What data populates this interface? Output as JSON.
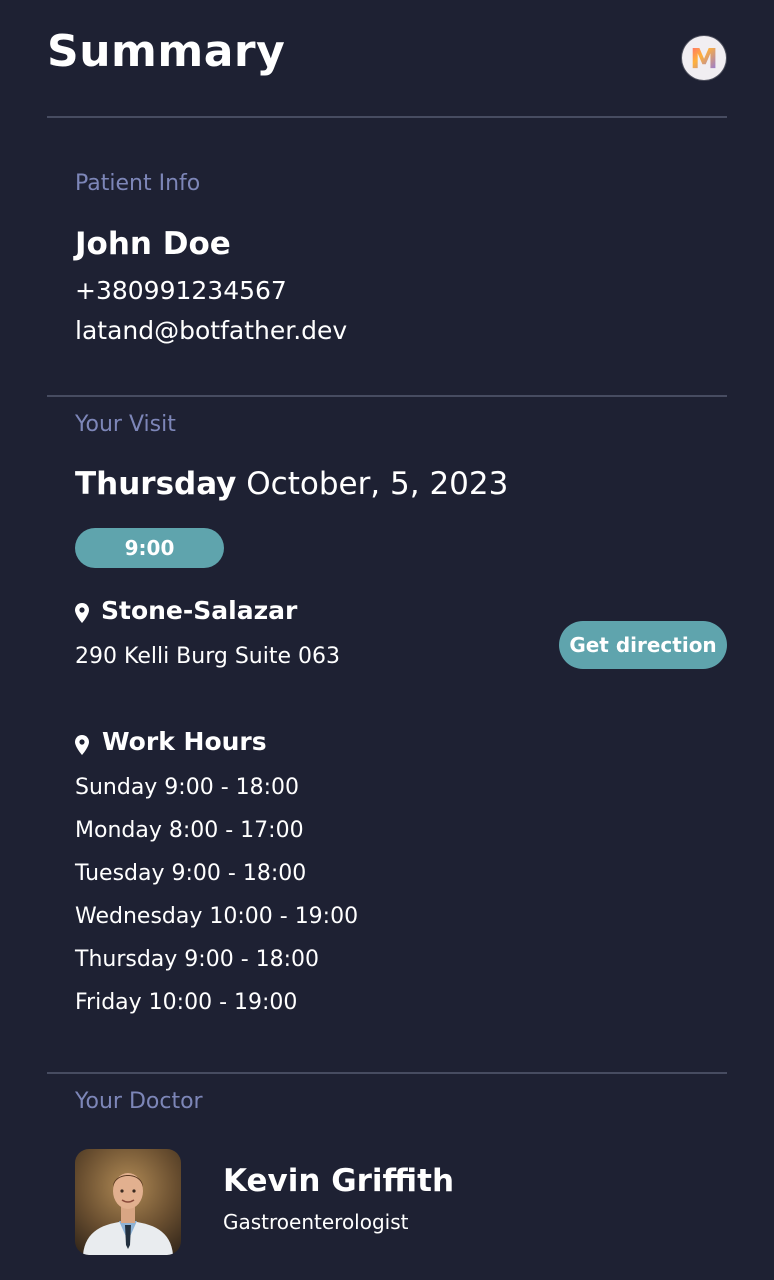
{
  "header": {
    "title": "Summary",
    "logo_letter": "M"
  },
  "patient": {
    "section_label": "Patient Info",
    "name": "John Doe",
    "phone": "+380991234567",
    "email": "latand@botfather.dev"
  },
  "visit": {
    "section_label": "Your Visit",
    "weekday": "Thursday",
    "date": "October, 5, 2023",
    "time": "9:00",
    "clinic_name": "Stone-Salazar",
    "clinic_address": "290 Kelli Burg Suite 063",
    "direction_button": "Get direction",
    "work_hours_title": "Work Hours",
    "work_hours": [
      "Sunday 9:00 - 18:00",
      "Monday 8:00 - 17:00",
      "Tuesday 9:00 - 18:00",
      "Wednesday 10:00 - 19:00",
      "Thursday 9:00 - 18:00",
      "Friday 10:00 - 19:00"
    ]
  },
  "doctor": {
    "section_label": "Your Doctor",
    "name": "Kevin Griffith",
    "specialty": "Gastroenterologist"
  },
  "colors": {
    "background": "#1e2133",
    "accent": "#5fa4ad",
    "label": "#7d86b8",
    "divider": "#474c61"
  },
  "icons": {
    "location": "map-pin-icon"
  }
}
